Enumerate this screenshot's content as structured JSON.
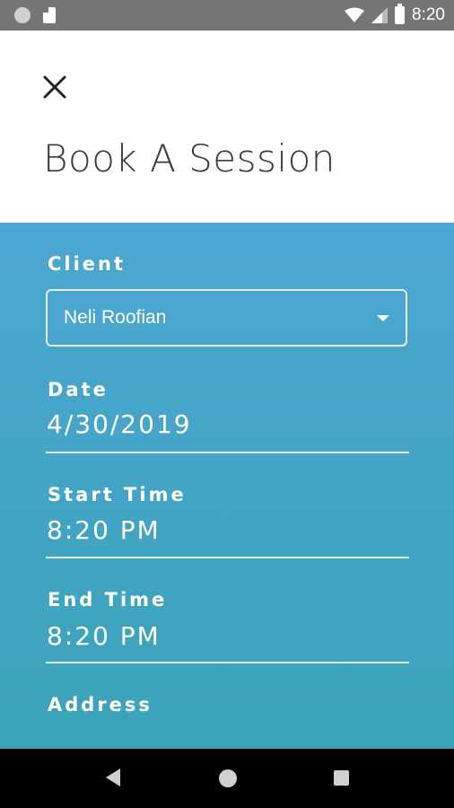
{
  "status": {
    "time": "8:20"
  },
  "header": {
    "title": "Book A Session"
  },
  "form": {
    "client_label": "Client",
    "client_value": "Neli Roofian",
    "date_label": "Date",
    "date_value": "4/30/2019",
    "start_label": "Start Time",
    "start_value": "8:20 PM",
    "end_label": "End Time",
    "end_value": "8:20 PM",
    "address_label": "Address"
  },
  "colors": {
    "gradient_top": "#4da6d3",
    "gradient_bottom": "#3aa3b8"
  }
}
